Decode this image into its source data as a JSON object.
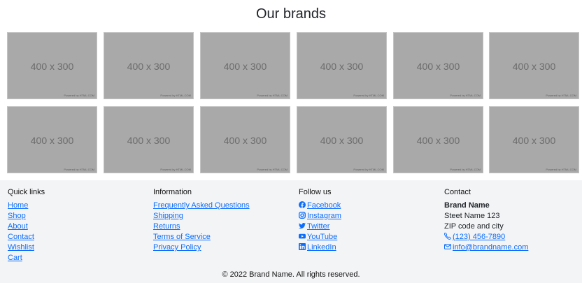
{
  "brands": {
    "title": "Our brands",
    "tiles": [
      {
        "size_label": "400 x 300",
        "credit": "Powered by HTML.COM"
      },
      {
        "size_label": "400 x 300",
        "credit": "Powered by HTML.COM"
      },
      {
        "size_label": "400 x 300",
        "credit": "Powered by HTML.COM"
      },
      {
        "size_label": "400 x 300",
        "credit": "Powered by HTML.COM"
      },
      {
        "size_label": "400 x 300",
        "credit": "Powered by HTML.COM"
      },
      {
        "size_label": "400 x 300",
        "credit": "Powered by HTML.COM"
      },
      {
        "size_label": "400 x 300",
        "credit": "Powered by HTML.COM"
      },
      {
        "size_label": "400 x 300",
        "credit": "Powered by HTML.COM"
      },
      {
        "size_label": "400 x 300",
        "credit": "Powered by HTML.COM"
      },
      {
        "size_label": "400 x 300",
        "credit": "Powered by HTML.COM"
      },
      {
        "size_label": "400 x 300",
        "credit": "Powered by HTML.COM"
      },
      {
        "size_label": "400 x 300",
        "credit": "Powered by HTML.COM"
      }
    ]
  },
  "footer": {
    "quick_links": {
      "heading": "Quick links",
      "items": [
        "Home",
        "Shop",
        "About",
        "Contact",
        "Wishlist",
        "Cart"
      ]
    },
    "information": {
      "heading": "Information",
      "items": [
        "Frequently Asked Questions",
        "Shipping",
        "Returns",
        "Terms of Service",
        "Privacy Policy"
      ]
    },
    "follow_us": {
      "heading": "Follow us",
      "items": [
        {
          "label": "Facebook",
          "icon": "facebook-icon"
        },
        {
          "label": "Instagram",
          "icon": "instagram-icon"
        },
        {
          "label": "Twitter",
          "icon": "twitter-icon"
        },
        {
          "label": "YouTube",
          "icon": "youtube-icon"
        },
        {
          "label": "LinkedIn",
          "icon": "linkedin-icon"
        }
      ]
    },
    "contact": {
      "heading": "Contact",
      "brand_name": "Brand Name",
      "street": "Steet Name 123",
      "zip_city": "ZIP code and city",
      "phone": "(123) 456-7890",
      "email": "info@brandname.com",
      "phone_icon": "phone-icon",
      "email_icon": "envelope-icon"
    },
    "copyright": "© 2022 Brand Name. All rights reserved."
  },
  "colors": {
    "link": "#0d6efd",
    "footer_bg": "#f3f4f6",
    "placeholder_bg": "#a9a9a9"
  }
}
